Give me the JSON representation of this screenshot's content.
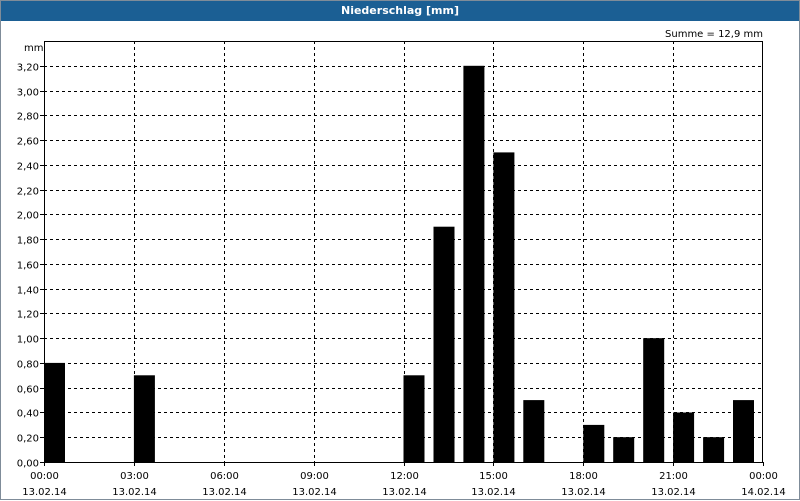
{
  "window": {
    "title": "Niederschlag [mm]"
  },
  "chart_data": {
    "type": "bar",
    "title": "Niederschlag [mm]",
    "ylabel": "mm",
    "annotation": "Summe = 12,9 mm",
    "ylim": [
      0,
      3.4
    ],
    "y_ticks": [
      "0,00",
      "0,20",
      "0,40",
      "0,60",
      "0,80",
      "1,00",
      "1,20",
      "1,40",
      "1,60",
      "1,80",
      "2,00",
      "2,20",
      "2,40",
      "2,60",
      "2,80",
      "3,00",
      "3,20"
    ],
    "x_ticks": [
      {
        "time": "00:00",
        "date": "13.02.14"
      },
      {
        "time": "03:00",
        "date": "13.02.14"
      },
      {
        "time": "06:00",
        "date": "13.02.14"
      },
      {
        "time": "09:00",
        "date": "13.02.14"
      },
      {
        "time": "12:00",
        "date": "13.02.14"
      },
      {
        "time": "15:00",
        "date": "13.02.14"
      },
      {
        "time": "18:00",
        "date": "13.02.14"
      },
      {
        "time": "21:00",
        "date": "13.02.14"
      },
      {
        "time": "00:00",
        "date": "14.02.14"
      }
    ],
    "x_unit": "hour",
    "bar_color": "#000000",
    "bars": [
      {
        "hour": 0,
        "value": 0.8
      },
      {
        "hour": 3,
        "value": 0.7
      },
      {
        "hour": 12,
        "value": 0.7
      },
      {
        "hour": 13,
        "value": 1.9
      },
      {
        "hour": 14,
        "value": 3.2
      },
      {
        "hour": 15,
        "value": 2.5
      },
      {
        "hour": 16,
        "value": 0.5
      },
      {
        "hour": 18,
        "value": 0.3
      },
      {
        "hour": 19,
        "value": 0.2
      },
      {
        "hour": 20,
        "value": 1.0
      },
      {
        "hour": 21,
        "value": 0.4
      },
      {
        "hour": 22,
        "value": 0.2
      },
      {
        "hour": 23,
        "value": 0.5
      }
    ],
    "grid": true
  }
}
